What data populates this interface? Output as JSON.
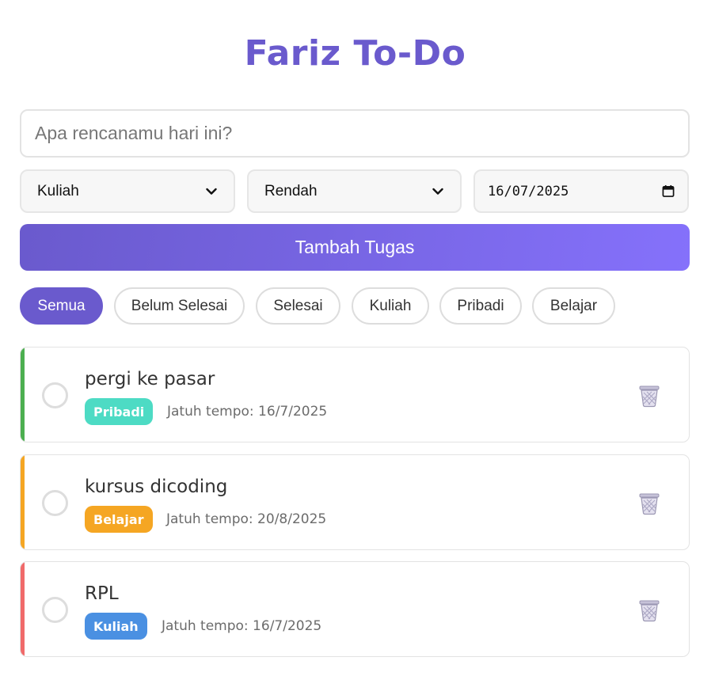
{
  "app": {
    "title": "Fariz To-Do"
  },
  "form": {
    "task_placeholder": "Apa rencanamu hari ini?",
    "task_value": "",
    "category_selected": "Kuliah",
    "priority_selected": "Rendah",
    "date_value": "16/07/2025",
    "add_label": "Tambah Tugas",
    "chevron_icon": "chevron-down-icon",
    "calendar_icon": "calendar-icon"
  },
  "filters": [
    {
      "label": "Semua",
      "active": true
    },
    {
      "label": "Belum Selesai",
      "active": false
    },
    {
      "label": "Selesai",
      "active": false
    },
    {
      "label": "Kuliah",
      "active": false
    },
    {
      "label": "Pribadi",
      "active": false
    },
    {
      "label": "Belajar",
      "active": false
    }
  ],
  "tasks": [
    {
      "name": "pergi ke pasar",
      "category": "Pribadi",
      "due": "Jatuh tempo: 16/7/2025",
      "bar_color": "#4caf50",
      "badge_color": "#4ddbc4",
      "done": false
    },
    {
      "name": "kursus dicoding",
      "category": "Belajar",
      "due": "Jatuh tempo: 20/8/2025",
      "bar_color": "#f5a623",
      "badge_color": "#f5a623",
      "done": false
    },
    {
      "name": "RPL",
      "category": "Kuliah",
      "due": "Jatuh tempo: 16/7/2025",
      "bar_color": "#f06a6a",
      "badge_color": "#4a90e2",
      "done": false
    }
  ],
  "colors": {
    "accent": "#6a5acd",
    "accent_light": "#8571fb"
  },
  "icons": {
    "delete": "trash-icon"
  }
}
